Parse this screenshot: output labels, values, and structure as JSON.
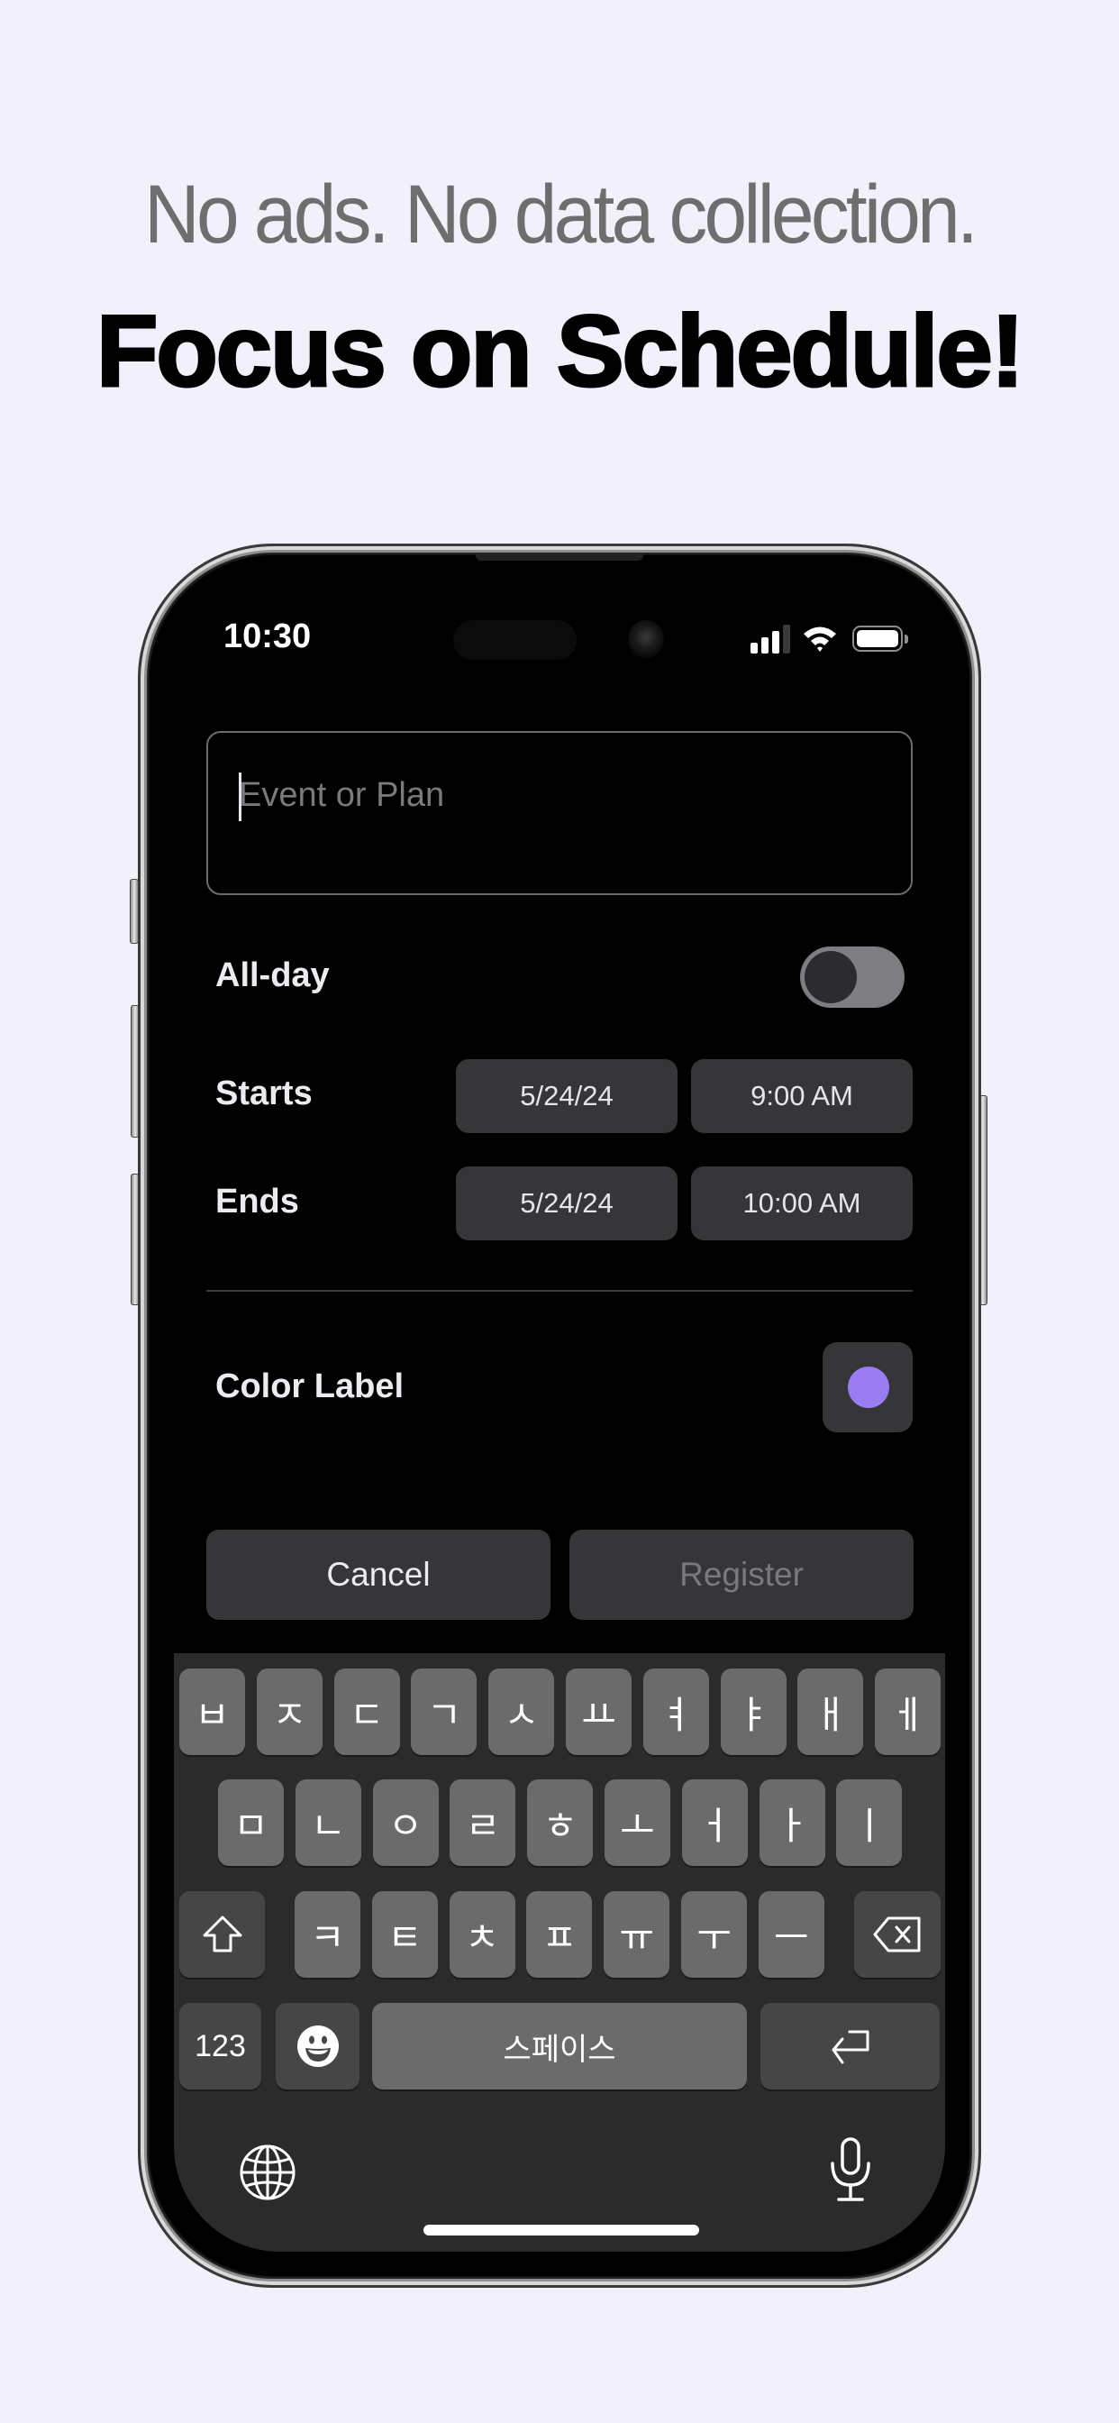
{
  "promo": {
    "tagline": "No ads. No data collection.",
    "headline": "Focus on Schedule!"
  },
  "status_bar": {
    "time": "10:30",
    "signal_bars": 3,
    "signal_bars_total": 4,
    "wifi_icon": "wifi-icon",
    "battery_level_percent": 100
  },
  "form": {
    "title_input": {
      "value": "",
      "placeholder": "Event or Plan",
      "focused": true
    },
    "all_day": {
      "label": "All-day",
      "on": false
    },
    "starts": {
      "label": "Starts",
      "date": "5/24/24",
      "time": "9:00 AM"
    },
    "ends": {
      "label": "Ends",
      "date": "5/24/24",
      "time": "10:00 AM"
    },
    "color_label": {
      "label": "Color Label",
      "color": "#9a7cf3"
    },
    "cancel_label": "Cancel",
    "register_label": "Register",
    "register_enabled": false
  },
  "keyboard": {
    "layout": "Korean 2-set",
    "row1": [
      "ㅂ",
      "ㅈ",
      "ㄷ",
      "ㄱ",
      "ㅅ",
      "ㅛ",
      "ㅕ",
      "ㅑ",
      "ㅐ",
      "ㅔ"
    ],
    "row2": [
      "ㅁ",
      "ㄴ",
      "ㅇ",
      "ㄹ",
      "ㅎ",
      "ㅗ",
      "ㅓ",
      "ㅏ",
      "ㅣ"
    ],
    "row3": [
      "ㅋ",
      "ㅌ",
      "ㅊ",
      "ㅍ",
      "ㅠ",
      "ㅜ",
      "ㅡ"
    ],
    "numbers_label": "123",
    "space_label": "스페이스",
    "shift_icon": "shift-icon",
    "backspace_icon": "backspace-icon",
    "emoji_icon": "emoji-icon",
    "return_icon": "return-icon",
    "globe_icon": "globe-icon",
    "mic_icon": "microphone-icon"
  },
  "colors": {
    "page_bg": "#f1f0fb",
    "screen_bg": "#000000",
    "control_bg": "#363638",
    "key_bg": "#6b6b6b",
    "key_fn_bg": "#464646",
    "keyboard_bg": "#2b2b2b",
    "accent_purple": "#9a7cf3",
    "disabled_text": "#7a7a7e"
  }
}
